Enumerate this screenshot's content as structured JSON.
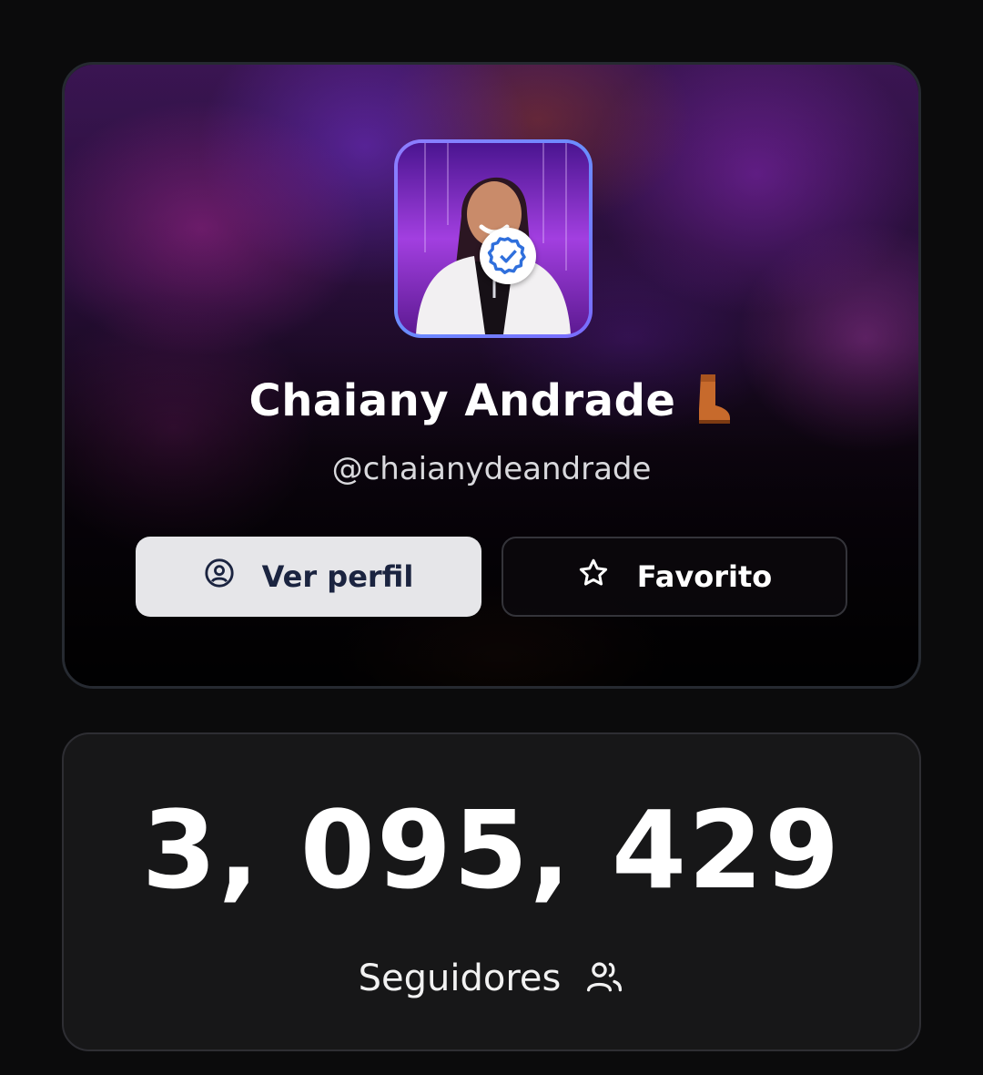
{
  "profile": {
    "name": "Chaiany Andrade",
    "name_emoji": "👢",
    "username": "@chaianydeandrade",
    "avatar_icon": "profile-photo",
    "verified_icon": "verified-badge-icon",
    "accent_border": "#8f7bff",
    "verified_color": "#2f6fdc"
  },
  "actions": {
    "view_profile_label": "Ver perfil",
    "view_profile_icon": "user-circle-icon",
    "favorite_label": "Favorito",
    "favorite_icon": "star-icon"
  },
  "stats": {
    "followers_count": "3, 095, 429",
    "followers_label": "Seguidores",
    "followers_icon": "users-icon"
  }
}
